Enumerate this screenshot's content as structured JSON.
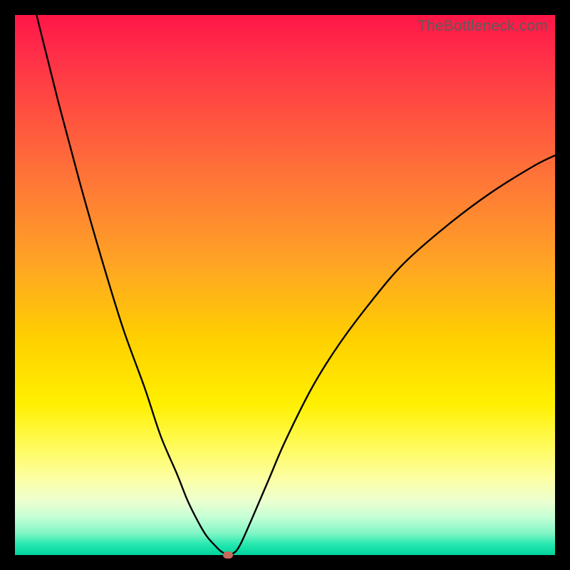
{
  "watermark": "TheBottleneck.com",
  "colors": {
    "frame": "#000000",
    "curve": "#000000",
    "marker": "#c66b5c",
    "gradient_top": "#ff1647",
    "gradient_bottom": "#00d49b"
  },
  "chart_data": {
    "type": "line",
    "title": "",
    "xlabel": "",
    "ylabel": "",
    "xlim": [
      0,
      100
    ],
    "ylim": [
      0,
      100
    ],
    "series": [
      {
        "name": "bottleneck-curve",
        "x": [
          0,
          4,
          8,
          12,
          16,
          20,
          24,
          27,
          30,
          32,
          34,
          35.5,
          37,
          38,
          38.8,
          39.5,
          40,
          41,
          42,
          44,
          47,
          50,
          55,
          60,
          66,
          72,
          80,
          88,
          96,
          100
        ],
        "values": [
          116,
          100,
          84,
          69,
          55,
          42,
          31,
          22,
          15,
          10,
          6,
          3.5,
          1.8,
          0.8,
          0.3,
          0.1,
          0.1,
          0.8,
          2.5,
          7,
          14,
          21,
          31,
          39,
          47,
          54,
          61,
          67,
          72,
          74
        ]
      }
    ],
    "marker": {
      "x": 39.5,
      "y": 0
    },
    "background": "vertical-gradient-red-to-green",
    "grid": false,
    "legend": false
  }
}
